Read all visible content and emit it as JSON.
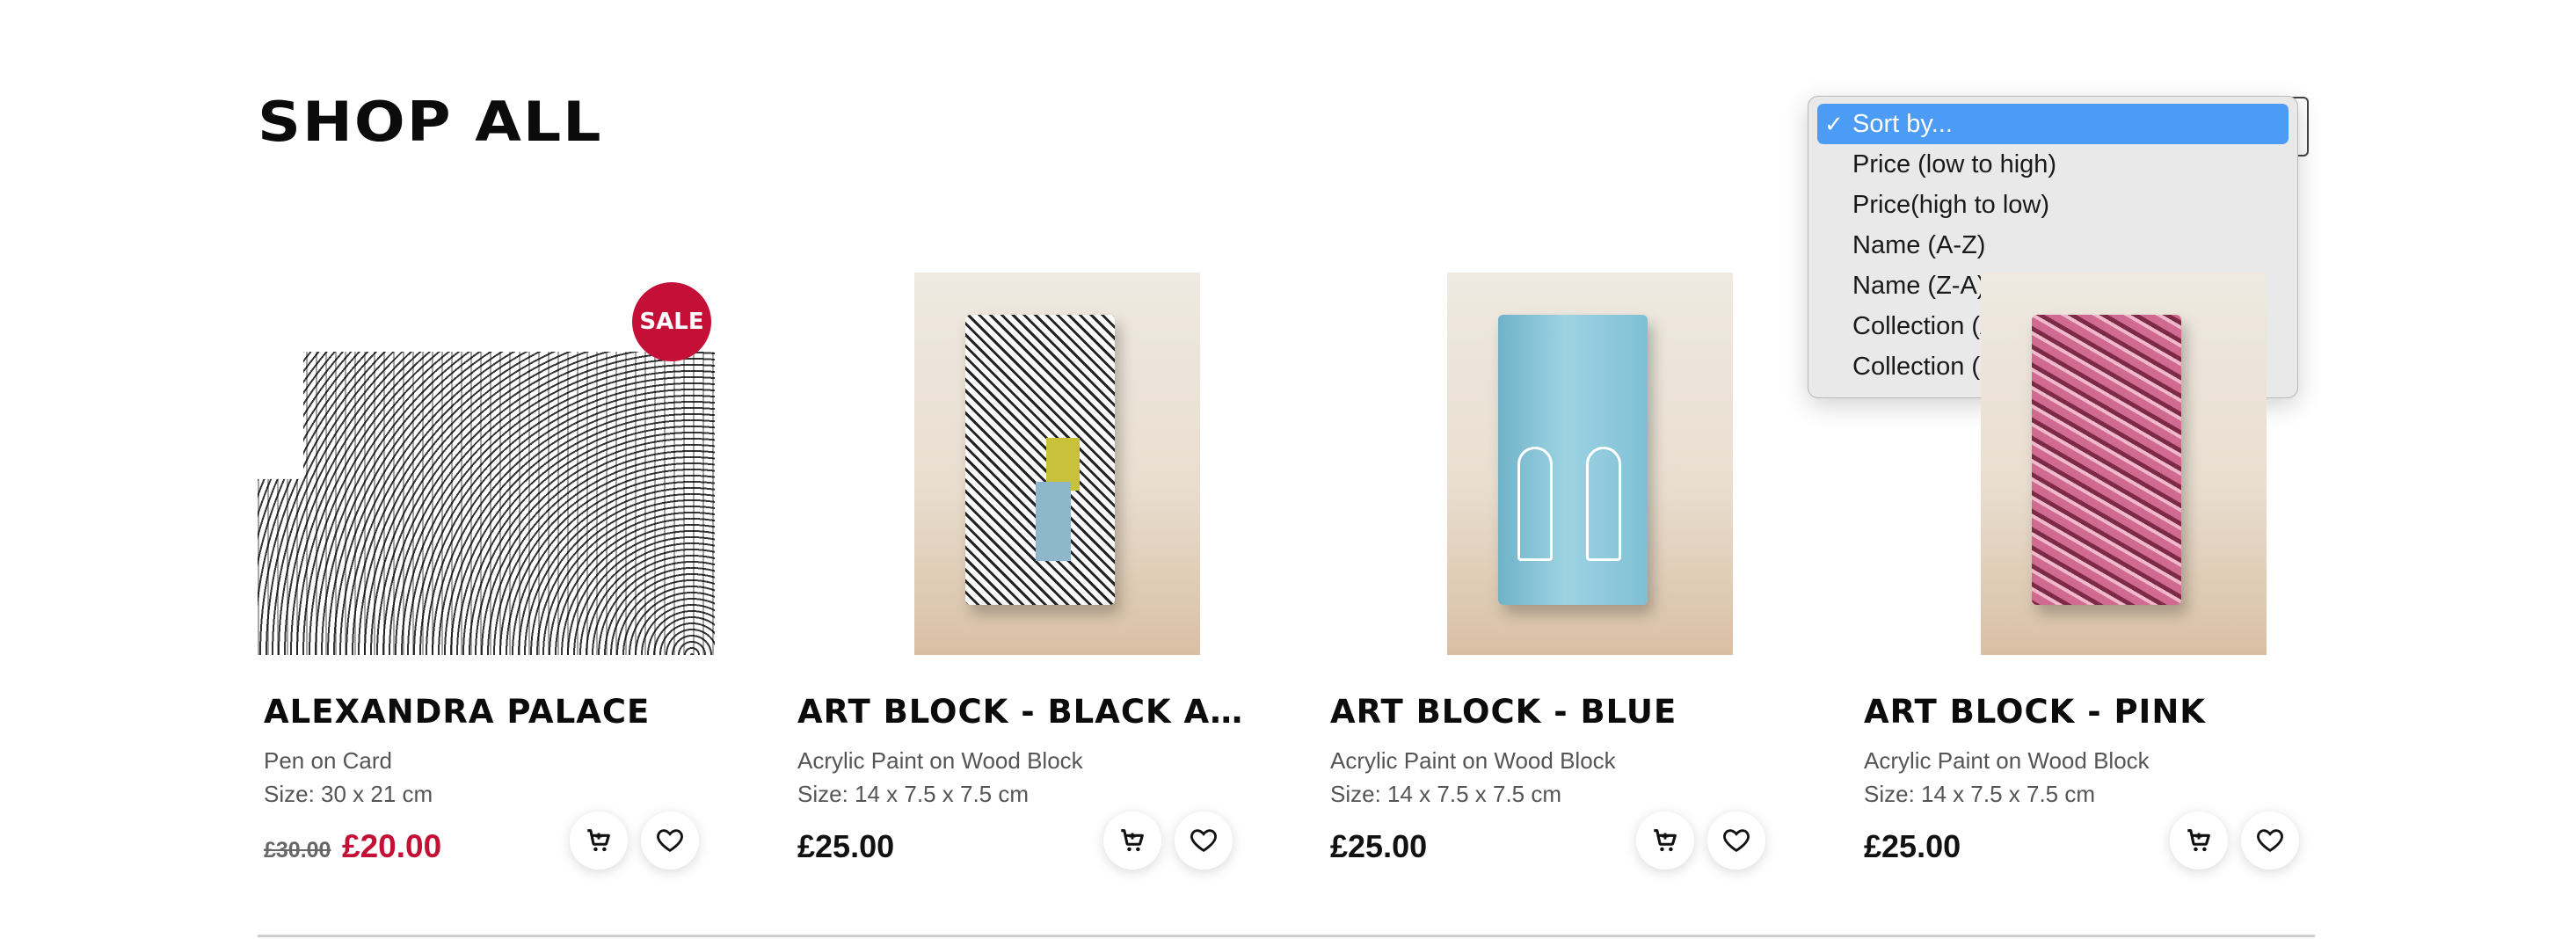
{
  "page": {
    "title": "SHOP ALL"
  },
  "sort": {
    "options": [
      {
        "label": "Sort by...",
        "selected": true
      },
      {
        "label": "Price (low to high)",
        "selected": false
      },
      {
        "label": "Price(high to low)",
        "selected": false
      },
      {
        "label": "Name (A-Z)",
        "selected": false
      },
      {
        "label": "Name (Z-A)",
        "selected": false
      },
      {
        "label": "Collection (A-Z)",
        "selected": false
      },
      {
        "label": "Collection (Z-A)",
        "selected": false
      }
    ],
    "highlight_color": "#4c9cf5"
  },
  "products": [
    {
      "name": "ALEXANDRA PALACE",
      "medium": "Pen on Card",
      "size": "Size: 30 x 21 cm",
      "badge": "SALE",
      "old_price": "£30.00",
      "price": "£20.00"
    },
    {
      "name": "ART BLOCK - BLACK AND...",
      "medium": "Acrylic Paint on Wood Block",
      "size": "Size: 14 x 7.5 x 7.5 cm",
      "price": "£25.00"
    },
    {
      "name": "ART BLOCK - BLUE",
      "medium": "Acrylic Paint on Wood Block",
      "size": "Size: 14 x 7.5 x 7.5 cm",
      "price": "£25.00"
    },
    {
      "name": "ART BLOCK - PINK",
      "medium": "Acrylic Paint on Wood Block",
      "size": "Size: 14 x 7.5 x 7.5 cm",
      "price": "£25.00"
    }
  ],
  "icons": {
    "cart": "cart-icon",
    "wishlist": "heart-icon",
    "check": "checkmark-icon"
  },
  "colors": {
    "sale": "#c41037",
    "text": "#0b0b0b"
  }
}
